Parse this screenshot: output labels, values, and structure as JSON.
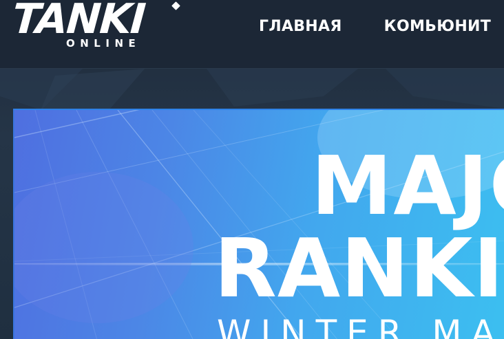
{
  "header": {
    "logo_main": "TANKI",
    "logo_sub": "ONLINE",
    "nav": [
      {
        "label": "ГЛАВНАЯ"
      },
      {
        "label": "КОМЬЮНИТ"
      }
    ]
  },
  "banner": {
    "title_line_1": "MAJO",
    "title_line_2": "RANKIN",
    "subtitle": "WINTER MAJ"
  },
  "colors": {
    "header_bg": "#1c2736",
    "banner_left": "#4f6fe0",
    "banner_right": "#3cbff0",
    "text": "#ffffff"
  }
}
